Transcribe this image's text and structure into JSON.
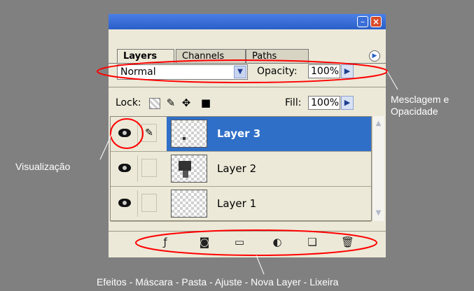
{
  "panel": {
    "tabs": [
      "Layers",
      "Channels",
      "Paths"
    ],
    "blend_mode": "Normal",
    "opacity_label": "Opacity:",
    "opacity_value": "100%",
    "lock_label": "Lock:",
    "fill_label": "Fill:",
    "fill_value": "100%",
    "layers": [
      {
        "name": "Layer 3",
        "selected": true
      },
      {
        "name": "Layer 2",
        "selected": false
      },
      {
        "name": "Layer 1",
        "selected": false
      }
    ],
    "icons": {
      "bottom": [
        "effects-icon",
        "mask-icon",
        "folder-icon",
        "adjustment-icon",
        "new-layer-icon",
        "trash-icon"
      ]
    }
  },
  "annotations": {
    "blend_line1": "Mesclagem e",
    "blend_line2": "Opacidade",
    "visibility": "Visualização",
    "bottom": "Efeitos - Máscara - Pasta - Ajuste - Nova Layer - Lixeira"
  },
  "colors": {
    "background": "#808080",
    "panel": "#ECE9D8",
    "selection": "#2F6FC8",
    "annotation_ellipse": "#FF0000"
  }
}
